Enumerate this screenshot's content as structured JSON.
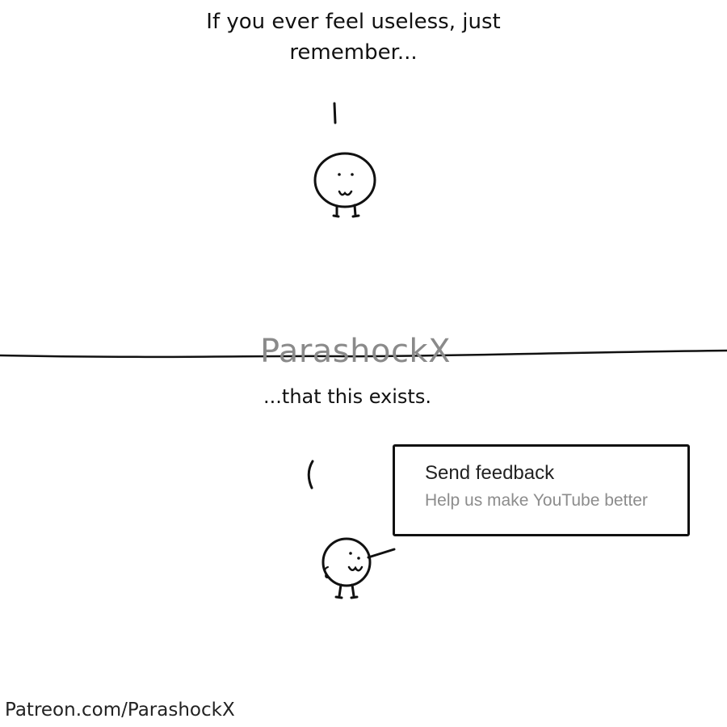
{
  "panel_top": {
    "caption": "If you ever feel useless, just remember..."
  },
  "panel_bottom": {
    "caption": "...that this exists."
  },
  "watermark": {
    "text": "ParashockX"
  },
  "feedback_item": {
    "title": "Send feedback",
    "subtitle": "Help us make YouTube better"
  },
  "footer": {
    "text": "Patreon.com/ParashockX"
  },
  "icons": {
    "top_character": "blob-character-icon",
    "bottom_character": "blob-character-pointing-icon",
    "top_motion_mark": "motion-line-icon",
    "bottom_motion_mark": "motion-arc-icon"
  },
  "colors": {
    "ink": "#111111",
    "watermark": "#8a8a8a",
    "subtitle": "#8c8c8c",
    "background": "#ffffff"
  }
}
